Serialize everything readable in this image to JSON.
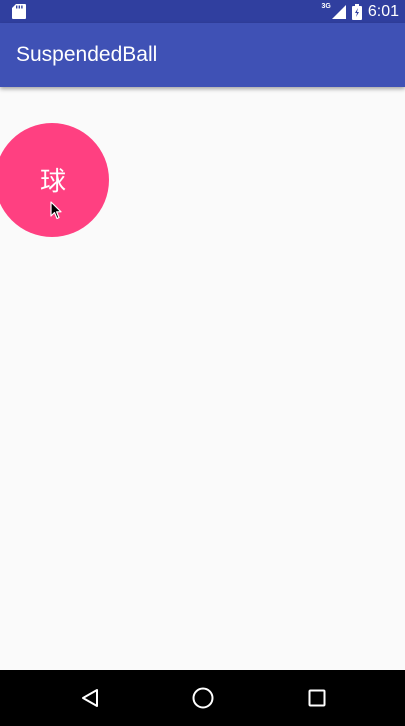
{
  "status_bar": {
    "network_type": "3G",
    "time": "6:01",
    "icons": [
      "sd-card-icon",
      "signal-icon",
      "battery-icon"
    ]
  },
  "app_bar": {
    "title": "SuspendedBall"
  },
  "ball": {
    "label": "球",
    "color": "#ff4081"
  },
  "nav_bar": {
    "icons": [
      "back-icon",
      "home-icon",
      "recents-icon"
    ]
  },
  "colors": {
    "primary": "#3f51b5",
    "primary_dark": "#303f9f",
    "accent": "#ff4081",
    "background": "#fafafa"
  }
}
